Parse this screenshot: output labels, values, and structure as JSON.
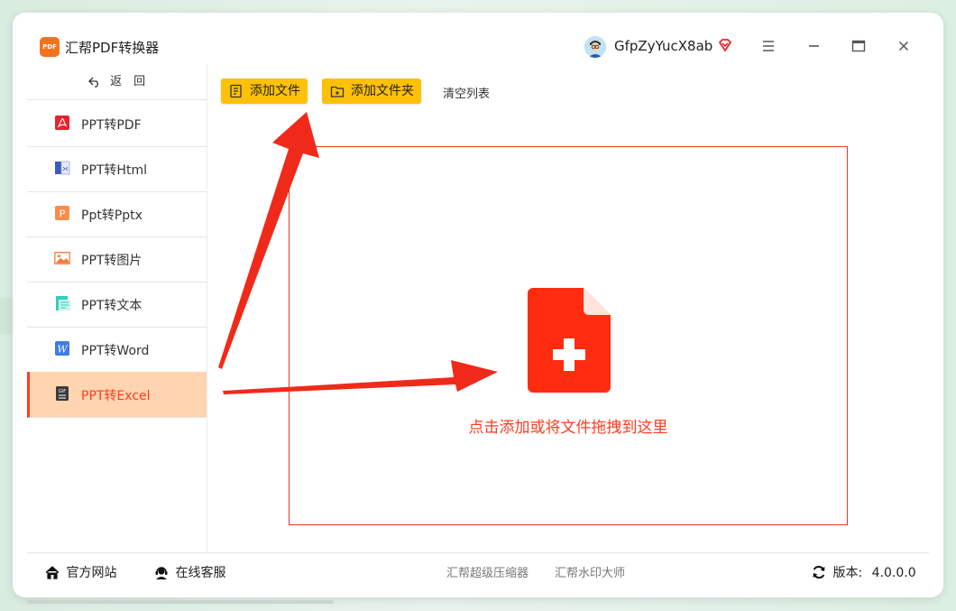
{
  "app": {
    "title": "汇帮PDF转换器",
    "logo_text": "PDF"
  },
  "user": {
    "name": "GfpZyYucX8ab"
  },
  "colors": {
    "accent": "#ff3b20",
    "button": "#ffc107",
    "active_bg": "#ffd4b0"
  },
  "sidebar": {
    "back_label": "返　回",
    "items": [
      {
        "label": "PPT转PDF",
        "icon": "pdf-icon"
      },
      {
        "label": "PPT转Html",
        "icon": "html-icon"
      },
      {
        "label": "Ppt转Pptx",
        "icon": "pptx-icon"
      },
      {
        "label": "PPT转图片",
        "icon": "image-icon"
      },
      {
        "label": "PPT转文本",
        "icon": "text-icon"
      },
      {
        "label": "PPT转Word",
        "icon": "word-icon"
      },
      {
        "label": "PPT转Excel",
        "icon": "excel-icon",
        "active": true
      }
    ]
  },
  "toolbar": {
    "add_file": "添加文件",
    "add_folder": "添加文件夹",
    "clear_list": "清空列表"
  },
  "dropzone": {
    "text": "点击添加或将文件拖拽到这里"
  },
  "footer": {
    "website": "官方网站",
    "support": "在线客服",
    "link1": "汇帮超级压缩器",
    "link2": "汇帮水印大师",
    "version_label": "版本:",
    "version": "4.0.0.0"
  }
}
